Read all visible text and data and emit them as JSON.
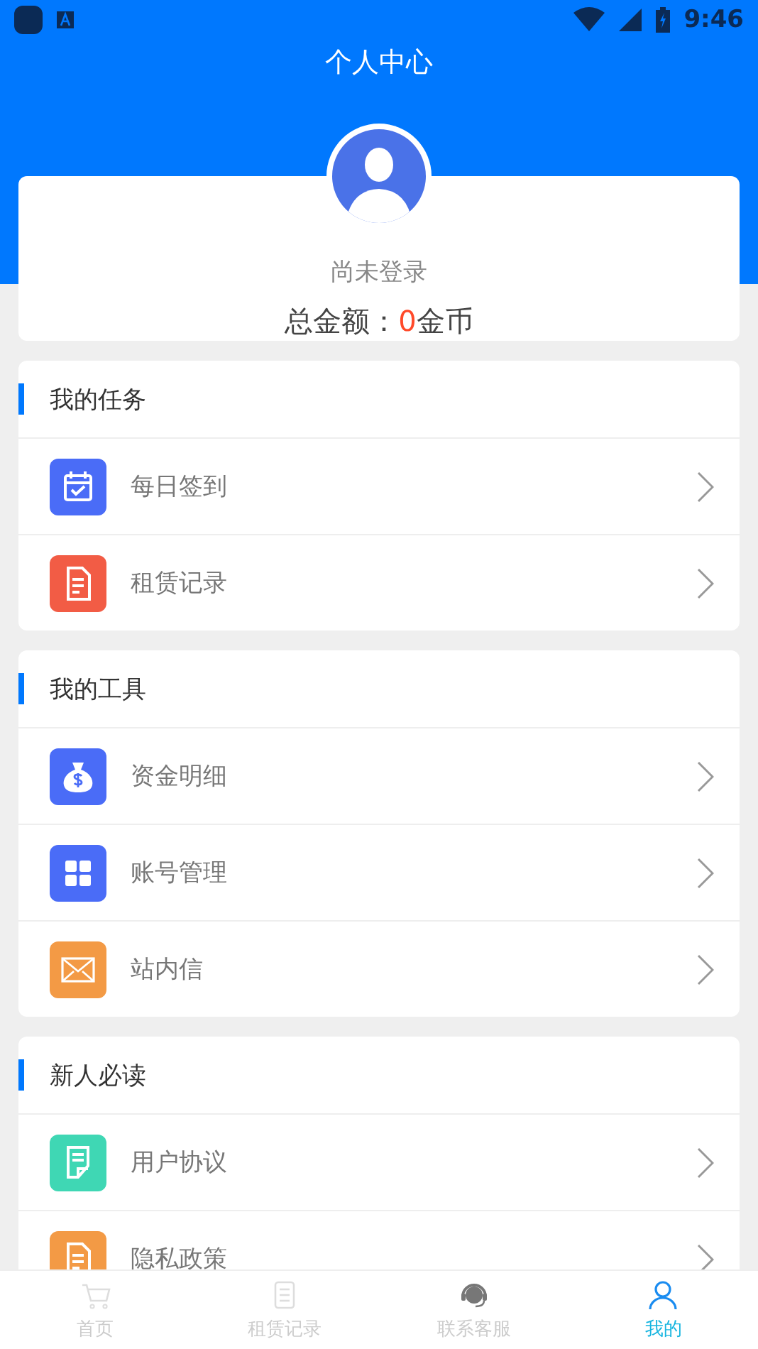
{
  "status_bar": {
    "time": "9:46"
  },
  "header": {
    "title": "个人中心"
  },
  "profile": {
    "login_status": "尚未登录",
    "balance_label": "总金额：",
    "balance_value": "0",
    "balance_unit": "金币"
  },
  "sections": [
    {
      "title": "我的任务",
      "items": [
        {
          "label": "每日签到",
          "kind": "calendar",
          "color": "#4a6cf7"
        },
        {
          "label": "租赁记录",
          "kind": "document",
          "color": "#f25c45"
        }
      ]
    },
    {
      "title": "我的工具",
      "items": [
        {
          "label": "资金明细",
          "kind": "moneybag",
          "color": "#4a6cf7"
        },
        {
          "label": "账号管理",
          "kind": "grid",
          "color": "#4a6cf7"
        },
        {
          "label": "站内信",
          "kind": "envelope",
          "color": "#f39a45"
        }
      ]
    },
    {
      "title": "新人必读",
      "items": [
        {
          "label": "用户协议",
          "kind": "note",
          "color": "#3fd7b4"
        },
        {
          "label": "隐私政策",
          "kind": "document",
          "color": "#f39a45"
        }
      ]
    }
  ],
  "tab_bar": [
    {
      "label": "首页",
      "kind": "cart",
      "selected": false
    },
    {
      "label": "租赁记录",
      "kind": "list",
      "selected": false
    },
    {
      "label": "联系客服",
      "kind": "headset",
      "selected": false
    },
    {
      "label": "我的",
      "kind": "person",
      "selected": true
    }
  ]
}
